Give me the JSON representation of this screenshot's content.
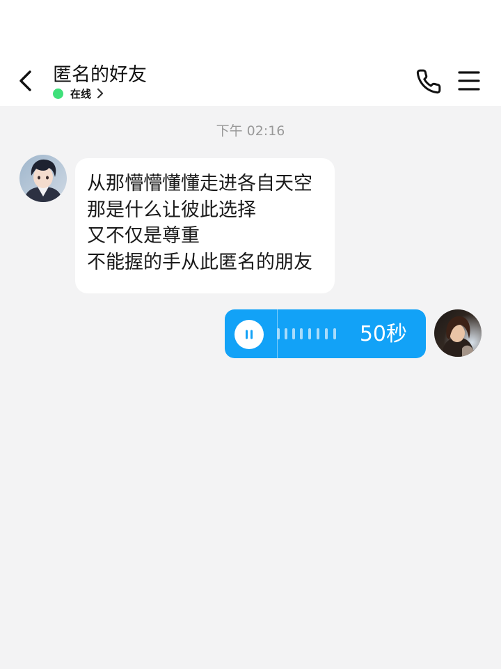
{
  "header": {
    "title": "匿名的好友",
    "status_text": "在线",
    "status_color": "#3fe07a",
    "back_icon": "chevron-left-icon",
    "call_icon": "phone-icon",
    "menu_icon": "hamburger-menu-icon"
  },
  "chat": {
    "timestamp": "下午 02:16",
    "messages": [
      {
        "side": "left",
        "lines": [
          "从那懵懵懂懂走进各自天空",
          "那是什么让彼此选择",
          "又不仅是尊重",
          "不能握的手从此匿名的朋友"
        ]
      },
      {
        "side": "right",
        "type": "voice",
        "duration": "50秒",
        "state": "playing",
        "accent_color": "#12a2f7"
      }
    ]
  }
}
